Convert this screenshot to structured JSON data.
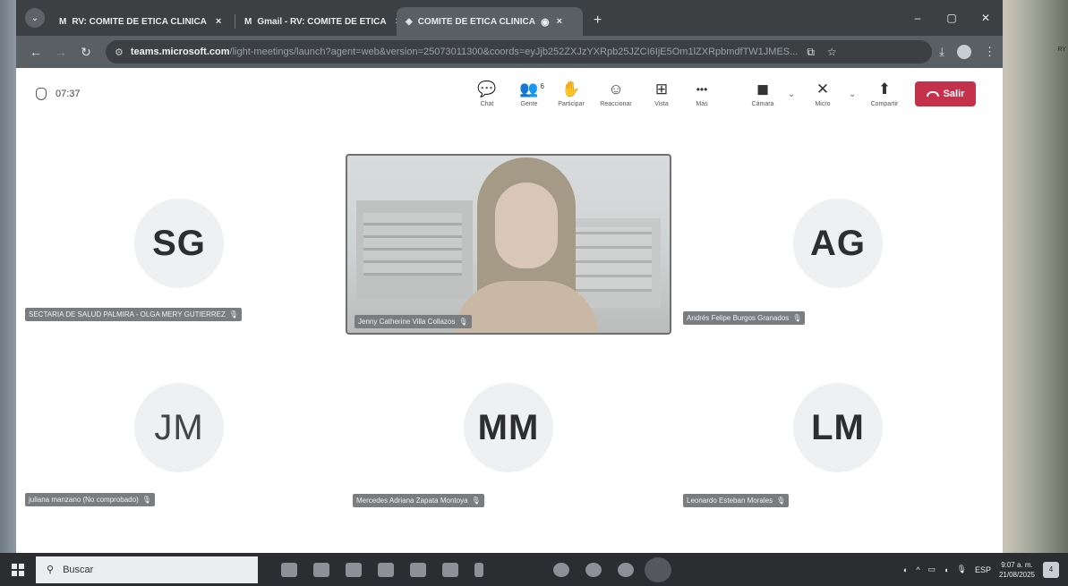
{
  "browser": {
    "tabs": [
      {
        "icon": "M",
        "title": "RV: COMITE DE ETICA CLINICA",
        "close": "×"
      },
      {
        "icon": "M",
        "title": "Gmail - RV: COMITE DE ETICA",
        "close": "×"
      },
      {
        "icon": "◈",
        "title": "COMITE DE ETICA CLINICA",
        "close": "×"
      }
    ],
    "new_tab": "+",
    "window_controls": [
      "–",
      "▢",
      "✕"
    ],
    "url_host": "teams.microsoft.com",
    "url_path": "/light-meetings/launch?agent=web&version=25073011300&coords=eyJjb252ZXJzYXRpb25JZCI6IjE5Om1lZXRpbmdfTW1JMES..."
  },
  "meeting": {
    "timer": "07:37",
    "controls": [
      {
        "name": "chat",
        "icon": "💬",
        "label": "Chat",
        "badge": ""
      },
      {
        "name": "people",
        "icon": "👥",
        "label": "Gente",
        "badge": "6"
      },
      {
        "name": "raise-hand",
        "icon": "✋",
        "label": "Participar",
        "badge": ""
      },
      {
        "name": "react",
        "icon": "☺",
        "label": "Reaccionar",
        "badge": ""
      },
      {
        "name": "view",
        "icon": "⊞",
        "label": "Vista",
        "badge": ""
      },
      {
        "name": "more",
        "icon": "•••",
        "label": "Más",
        "badge": ""
      },
      {
        "name": "camera",
        "icon": "◼",
        "label": "Cámara",
        "badge": ""
      },
      {
        "name": "mic",
        "icon": "✕",
        "label": "Micro",
        "badge": ""
      },
      {
        "name": "share",
        "icon": "⬆",
        "label": "Compartir",
        "badge": ""
      }
    ],
    "leave_label": "Salir",
    "participants": [
      {
        "initials": "SG",
        "name": "SECTARIA DE SALUD PALMIRA - OLGA MERY GUTIERREZ"
      },
      {
        "initials": "",
        "name": "Jenny Catherine Villa Collazos"
      },
      {
        "initials": "AG",
        "name": "Andrés Felipe Burgos Granados"
      },
      {
        "initials": "JM",
        "name": "juliana manzano (No comprobado)"
      },
      {
        "initials": "MM",
        "name": "Mercedes Adriana Zapata Montoya"
      },
      {
        "initials": "LM",
        "name": "Leonardo Esteban Morales"
      }
    ]
  },
  "taskbar": {
    "search_placeholder": "Buscar",
    "language": "ESP",
    "time": "9:07 a. m.",
    "date": "21/08/2025",
    "notifications": "4"
  },
  "desktop_side_text": "RY"
}
